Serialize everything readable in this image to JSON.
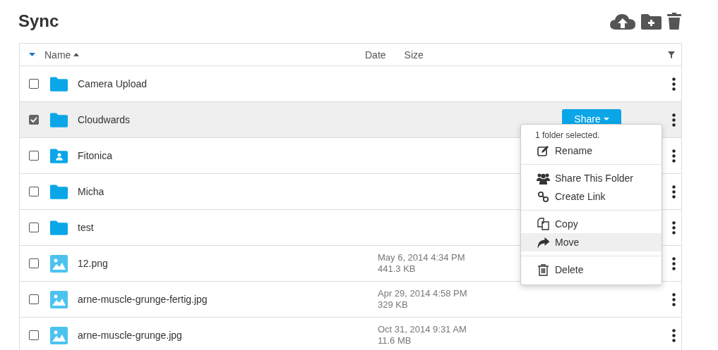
{
  "title": "Sync",
  "toolbar": [
    {
      "kind": "upload"
    },
    {
      "kind": "new-folder"
    },
    {
      "kind": "delete"
    }
  ],
  "table": {
    "columns": [
      {
        "label": "Name",
        "sorted": true
      },
      {
        "label": "Date",
        "sorted": false
      },
      {
        "label": "Size",
        "sorted": false
      }
    ],
    "rows": [
      {
        "kind": "folder",
        "name": "Camera Upload",
        "checked": false
      },
      {
        "kind": "folder",
        "name": "Cloudwards",
        "checked": true,
        "action": "Share"
      },
      {
        "kind": "shared-folder",
        "name": "Fitonica",
        "checked": false
      },
      {
        "kind": "folder",
        "name": "Micha",
        "checked": false
      },
      {
        "kind": "folder",
        "name": "test",
        "checked": false
      },
      {
        "kind": "image",
        "name": "12.png",
        "checked": false,
        "date": "May 6, 2014 4:34 PM",
        "size": "441.3 KB"
      },
      {
        "kind": "image",
        "name": "arne-muscle-grunge-fertig.jpg",
        "checked": false,
        "date": "Apr 29, 2014 4:58 PM",
        "size": "329 KB"
      },
      {
        "kind": "image",
        "name": "arne-muscle-grunge.jpg",
        "checked": false,
        "date": "Oct 31, 2014 9:31 AM",
        "size": "11.6 MB"
      }
    ]
  },
  "context_menu": {
    "caption": "1 folder selected.",
    "groups": [
      [
        {
          "kind": "rename",
          "label": "Rename",
          "highlighted": false
        }
      ],
      [
        {
          "kind": "share",
          "label": "Share This Folder",
          "highlighted": false
        },
        {
          "kind": "link",
          "label": "Create Link",
          "highlighted": false
        }
      ],
      [
        {
          "kind": "copy",
          "label": "Copy",
          "highlighted": false
        },
        {
          "kind": "move",
          "label": "Move",
          "highlighted": true
        }
      ],
      [
        {
          "kind": "delete",
          "label": "Delete",
          "highlighted": false
        }
      ]
    ]
  }
}
